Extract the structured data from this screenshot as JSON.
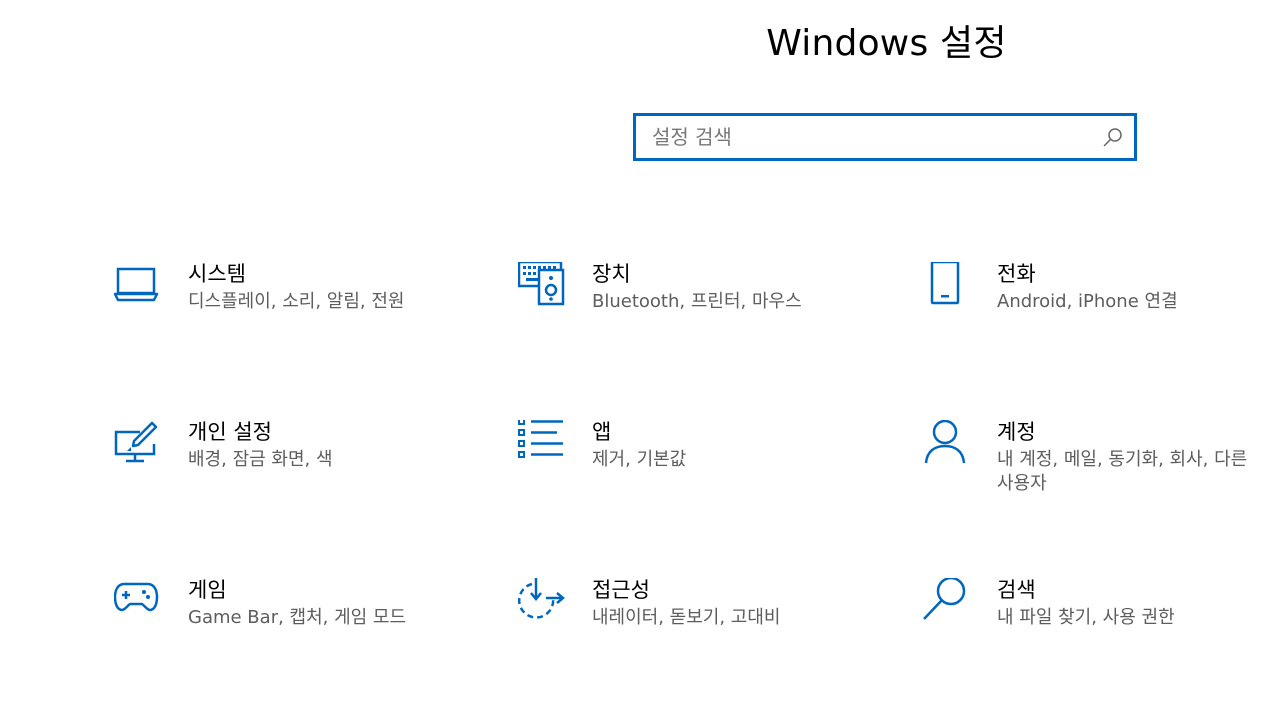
{
  "header": {
    "title": "Windows 설정"
  },
  "search": {
    "placeholder": "설정 검색",
    "value": ""
  },
  "accent_color": "#0067c0",
  "tiles": [
    {
      "name": "시스템",
      "desc": "디스플레이, 소리, 알림, 전원",
      "icon": "laptop-icon"
    },
    {
      "name": "장치",
      "desc": "Bluetooth, 프린터, 마우스",
      "icon": "devices-icon"
    },
    {
      "name": "전화",
      "desc": "Android, iPhone 연결",
      "icon": "phone-icon"
    },
    {
      "name": "개인 설정",
      "desc": "배경, 잠금 화면, 색",
      "icon": "personalization-icon"
    },
    {
      "name": "앱",
      "desc": "제거, 기본값",
      "icon": "apps-list-icon"
    },
    {
      "name": "계정",
      "desc": "내 계정, 메일, 동기화, 회사, 다른 사용자",
      "icon": "person-icon"
    },
    {
      "name": "게임",
      "desc": "Game Bar, 캡처, 게임 모드",
      "icon": "gamepad-icon"
    },
    {
      "name": "접근성",
      "desc": "내레이터, 돋보기, 고대비",
      "icon": "ease-of-access-icon"
    },
    {
      "name": "검색",
      "desc": "내 파일 찾기, 사용 권한",
      "icon": "search-icon"
    }
  ]
}
